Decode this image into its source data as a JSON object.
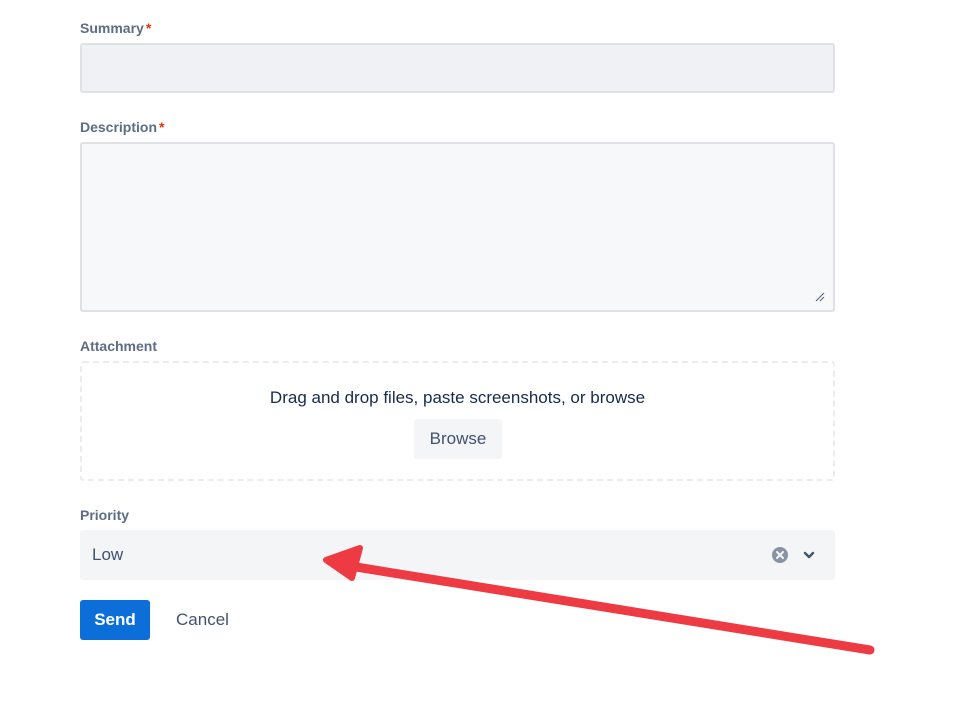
{
  "form": {
    "summary": {
      "label": "Summary",
      "required_mark": "*",
      "value": ""
    },
    "description": {
      "label": "Description",
      "required_mark": "*",
      "value": ""
    },
    "attachment": {
      "label": "Attachment",
      "dropzone_text": "Drag and drop files, paste screenshots, or browse",
      "browse_label": "Browse"
    },
    "priority": {
      "label": "Priority",
      "selected_value": "Low",
      "clear_icon": "clear-circle-icon",
      "dropdown_icon": "chevron-down-icon"
    },
    "actions": {
      "send_label": "Send",
      "cancel_label": "Cancel"
    }
  },
  "colors": {
    "primary_button": "#0c6fd9",
    "required_mark": "#de350b",
    "label_text": "#5e6c84",
    "annotation_arrow": "#ee3b43"
  },
  "annotation": {
    "type": "arrow",
    "points_to": "priority-select"
  }
}
